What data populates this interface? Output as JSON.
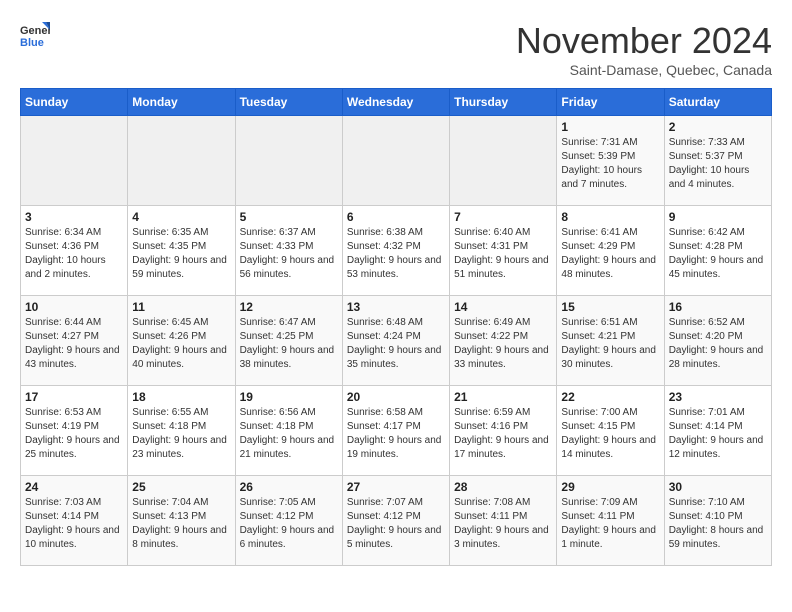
{
  "header": {
    "logo_general": "General",
    "logo_blue": "Blue",
    "month_title": "November 2024",
    "subtitle": "Saint-Damase, Quebec, Canada"
  },
  "weekdays": [
    "Sunday",
    "Monday",
    "Tuesday",
    "Wednesday",
    "Thursday",
    "Friday",
    "Saturday"
  ],
  "weeks": [
    [
      {
        "day": "",
        "info": ""
      },
      {
        "day": "",
        "info": ""
      },
      {
        "day": "",
        "info": ""
      },
      {
        "day": "",
        "info": ""
      },
      {
        "day": "",
        "info": ""
      },
      {
        "day": "1",
        "info": "Sunrise: 7:31 AM\nSunset: 5:39 PM\nDaylight: 10 hours and 7 minutes."
      },
      {
        "day": "2",
        "info": "Sunrise: 7:33 AM\nSunset: 5:37 PM\nDaylight: 10 hours and 4 minutes."
      }
    ],
    [
      {
        "day": "3",
        "info": "Sunrise: 6:34 AM\nSunset: 4:36 PM\nDaylight: 10 hours and 2 minutes."
      },
      {
        "day": "4",
        "info": "Sunrise: 6:35 AM\nSunset: 4:35 PM\nDaylight: 9 hours and 59 minutes."
      },
      {
        "day": "5",
        "info": "Sunrise: 6:37 AM\nSunset: 4:33 PM\nDaylight: 9 hours and 56 minutes."
      },
      {
        "day": "6",
        "info": "Sunrise: 6:38 AM\nSunset: 4:32 PM\nDaylight: 9 hours and 53 minutes."
      },
      {
        "day": "7",
        "info": "Sunrise: 6:40 AM\nSunset: 4:31 PM\nDaylight: 9 hours and 51 minutes."
      },
      {
        "day": "8",
        "info": "Sunrise: 6:41 AM\nSunset: 4:29 PM\nDaylight: 9 hours and 48 minutes."
      },
      {
        "day": "9",
        "info": "Sunrise: 6:42 AM\nSunset: 4:28 PM\nDaylight: 9 hours and 45 minutes."
      }
    ],
    [
      {
        "day": "10",
        "info": "Sunrise: 6:44 AM\nSunset: 4:27 PM\nDaylight: 9 hours and 43 minutes."
      },
      {
        "day": "11",
        "info": "Sunrise: 6:45 AM\nSunset: 4:26 PM\nDaylight: 9 hours and 40 minutes."
      },
      {
        "day": "12",
        "info": "Sunrise: 6:47 AM\nSunset: 4:25 PM\nDaylight: 9 hours and 38 minutes."
      },
      {
        "day": "13",
        "info": "Sunrise: 6:48 AM\nSunset: 4:24 PM\nDaylight: 9 hours and 35 minutes."
      },
      {
        "day": "14",
        "info": "Sunrise: 6:49 AM\nSunset: 4:22 PM\nDaylight: 9 hours and 33 minutes."
      },
      {
        "day": "15",
        "info": "Sunrise: 6:51 AM\nSunset: 4:21 PM\nDaylight: 9 hours and 30 minutes."
      },
      {
        "day": "16",
        "info": "Sunrise: 6:52 AM\nSunset: 4:20 PM\nDaylight: 9 hours and 28 minutes."
      }
    ],
    [
      {
        "day": "17",
        "info": "Sunrise: 6:53 AM\nSunset: 4:19 PM\nDaylight: 9 hours and 25 minutes."
      },
      {
        "day": "18",
        "info": "Sunrise: 6:55 AM\nSunset: 4:18 PM\nDaylight: 9 hours and 23 minutes."
      },
      {
        "day": "19",
        "info": "Sunrise: 6:56 AM\nSunset: 4:18 PM\nDaylight: 9 hours and 21 minutes."
      },
      {
        "day": "20",
        "info": "Sunrise: 6:58 AM\nSunset: 4:17 PM\nDaylight: 9 hours and 19 minutes."
      },
      {
        "day": "21",
        "info": "Sunrise: 6:59 AM\nSunset: 4:16 PM\nDaylight: 9 hours and 17 minutes."
      },
      {
        "day": "22",
        "info": "Sunrise: 7:00 AM\nSunset: 4:15 PM\nDaylight: 9 hours and 14 minutes."
      },
      {
        "day": "23",
        "info": "Sunrise: 7:01 AM\nSunset: 4:14 PM\nDaylight: 9 hours and 12 minutes."
      }
    ],
    [
      {
        "day": "24",
        "info": "Sunrise: 7:03 AM\nSunset: 4:14 PM\nDaylight: 9 hours and 10 minutes."
      },
      {
        "day": "25",
        "info": "Sunrise: 7:04 AM\nSunset: 4:13 PM\nDaylight: 9 hours and 8 minutes."
      },
      {
        "day": "26",
        "info": "Sunrise: 7:05 AM\nSunset: 4:12 PM\nDaylight: 9 hours and 6 minutes."
      },
      {
        "day": "27",
        "info": "Sunrise: 7:07 AM\nSunset: 4:12 PM\nDaylight: 9 hours and 5 minutes."
      },
      {
        "day": "28",
        "info": "Sunrise: 7:08 AM\nSunset: 4:11 PM\nDaylight: 9 hours and 3 minutes."
      },
      {
        "day": "29",
        "info": "Sunrise: 7:09 AM\nSunset: 4:11 PM\nDaylight: 9 hours and 1 minute."
      },
      {
        "day": "30",
        "info": "Sunrise: 7:10 AM\nSunset: 4:10 PM\nDaylight: 8 hours and 59 minutes."
      }
    ]
  ]
}
